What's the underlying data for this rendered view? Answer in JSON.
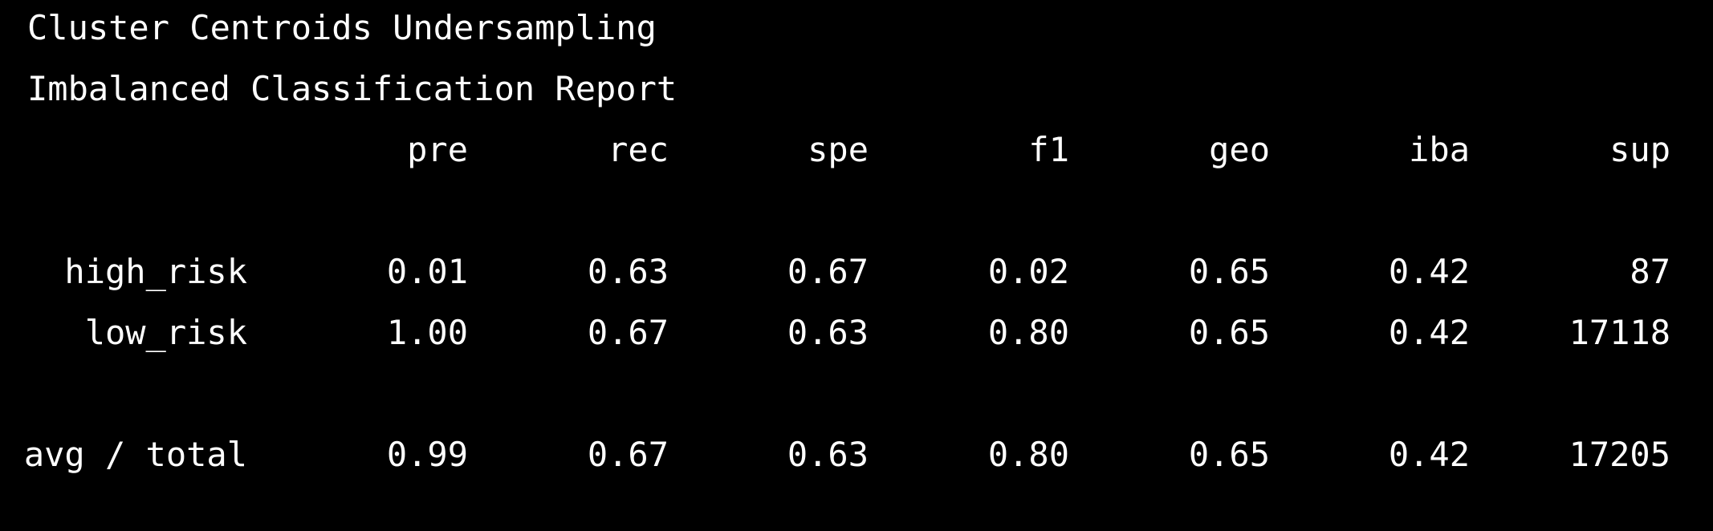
{
  "title": "Cluster Centroids Undersampling",
  "subtitle": "Imbalanced Classification Report",
  "columns": [
    "pre",
    "rec",
    "spe",
    "f1",
    "geo",
    "iba",
    "sup"
  ],
  "rows": [
    {
      "label": "high_risk",
      "values": [
        "0.01",
        "0.63",
        "0.67",
        "0.02",
        "0.65",
        "0.42",
        "87"
      ]
    },
    {
      "label": "low_risk",
      "values": [
        "1.00",
        "0.67",
        "0.63",
        "0.80",
        "0.65",
        "0.42",
        "17118"
      ]
    }
  ],
  "total": {
    "label": "avg / total",
    "values": [
      "0.99",
      "0.67",
      "0.63",
      "0.80",
      "0.65",
      "0.42",
      "17205"
    ]
  }
}
